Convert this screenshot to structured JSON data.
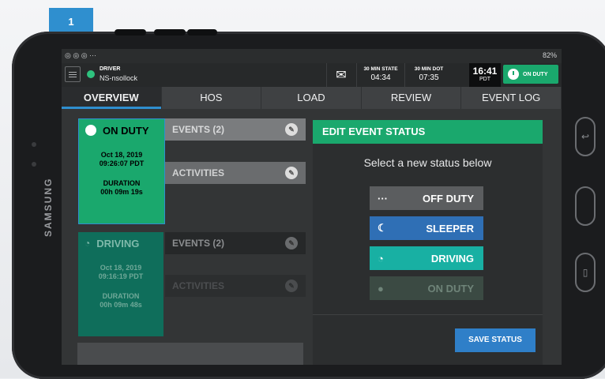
{
  "step_badge": "1",
  "device_brand": "SAMSUNG",
  "status_bar": {
    "icons_left": "◎ ◎ ◎ ···",
    "right": "82%"
  },
  "app_bar": {
    "driver_label": "DRIVER",
    "driver_name": "NS-nsollock",
    "timers": [
      {
        "label": "30 MIN STATE",
        "value": "04:34"
      },
      {
        "label": "30 MIN DOT",
        "value": "07:35"
      }
    ],
    "clock_time": "16:41",
    "clock_tz": "PDT",
    "duty_pill": "ON DUTY"
  },
  "tabs": [
    "OVERVIEW",
    "HOS",
    "LOAD",
    "REVIEW",
    "EVENT LOG"
  ],
  "status_cards": [
    {
      "title": "ON DUTY",
      "date": "Oct 18, 2019",
      "time": "09:26:07 PDT",
      "duration_label": "DURATION",
      "duration": "00h 09m 19s"
    },
    {
      "title": "DRIVING",
      "date": "Oct 18, 2019",
      "time": "09:16:19 PDT",
      "duration_label": "DURATION",
      "duration": "00h 09m 48s"
    }
  ],
  "side_blocks": {
    "events_1": "EVENTS (2)",
    "activities_1": "ACTIVITIES",
    "events_2": "EVENTS (2)",
    "activities_2": "ACTIVITIES"
  },
  "edit_panel": {
    "title": "EDIT EVENT STATUS",
    "subtitle": "Select a new status below",
    "options": [
      {
        "label": "OFF DUTY",
        "icon": "···",
        "color": "#5b5d5f"
      },
      {
        "label": "SLEEPER",
        "icon": "☾",
        "color": "#2f6fb5"
      },
      {
        "label": "DRIVING",
        "icon": "◔",
        "color": "#18b0a3"
      },
      {
        "label": "ON DUTY",
        "icon": "●",
        "color": "#3b4a43"
      }
    ],
    "save_label": "SAVE STATUS"
  },
  "colors": {
    "accent_green": "#1aa86d",
    "driving_teal": "#0f6e5b",
    "blue": "#2f8fcf"
  }
}
